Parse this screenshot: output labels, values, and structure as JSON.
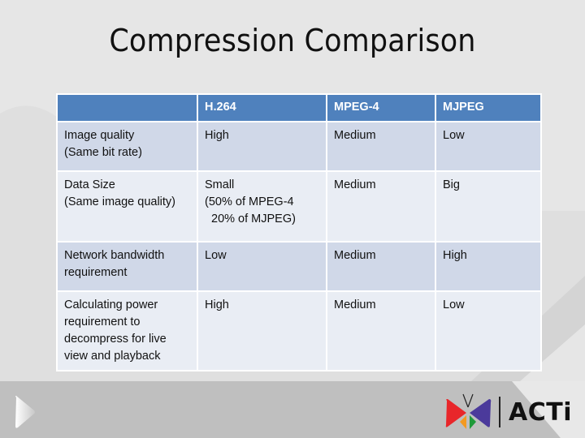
{
  "slide": {
    "title": "Compression Comparison"
  },
  "table": {
    "headers": [
      "",
      "H.264",
      "MPEG-4",
      "MJPEG"
    ],
    "rows": [
      {
        "label": [
          "Image quality",
          "(Same bit rate)"
        ],
        "h264": [
          "High"
        ],
        "mpeg4": "Medium",
        "mjpeg": "Low"
      },
      {
        "label": [
          "Data Size",
          "(Same image quality)"
        ],
        "h264": [
          "Small",
          "(50% of MPEG-4",
          "20% of MJPEG)"
        ],
        "mpeg4": "Medium",
        "mjpeg": "Big"
      },
      {
        "label": [
          "Network bandwidth",
          "requirement"
        ],
        "h264": [
          "Low"
        ],
        "mpeg4": "Medium",
        "mjpeg": "High"
      },
      {
        "label": [
          "Calculating power",
          "requirement to",
          "decompress for live",
          "view and playback"
        ],
        "h264": [
          "High"
        ],
        "mpeg4": "Medium",
        "mjpeg": "Low"
      }
    ]
  },
  "footer": {
    "logo_text": "ACTi",
    "play_icon": "play-arrow-icon",
    "logo_icon": "butterfly-logo-icon"
  },
  "colors": {
    "header": "#4f81bd",
    "row_dark": "#d0d8e8",
    "row_light": "#e9edf4",
    "logo_red": "#e8262a",
    "logo_purple": "#4b3a9b",
    "logo_orange": "#f39a21",
    "logo_green": "#1f9a3a"
  }
}
